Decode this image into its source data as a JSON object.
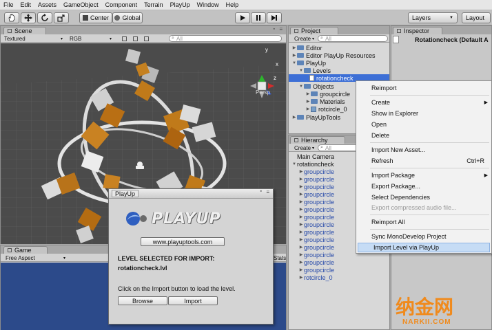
{
  "menu": [
    "File",
    "Edit",
    "Assets",
    "GameObject",
    "Component",
    "Terrain",
    "PlayUp",
    "Window",
    "Help"
  ],
  "toolbar": {
    "pivot": "Center",
    "space": "Global",
    "layers": "Layers",
    "layout": "Layout"
  },
  "scene": {
    "tab": "Scene",
    "shading": "Textured",
    "render_mode": "RGB",
    "search_placeholder": "All",
    "persp": "Persp",
    "gizmo_axes": [
      "y",
      "x",
      "z"
    ]
  },
  "game": {
    "tab": "Game",
    "aspect": "Free Aspect",
    "stats": "Stats"
  },
  "project": {
    "tab": "Project",
    "create": "Create",
    "search_placeholder": "All",
    "items": [
      {
        "label": "Editor",
        "icon": "folder-icon",
        "expanded": false
      },
      {
        "label": "Editor PlayUp Resources",
        "icon": "folder-icon",
        "expanded": false
      },
      {
        "label": "PlayUp",
        "icon": "folder-icon",
        "expanded": true
      },
      {
        "label": "Levels",
        "icon": "folder-icon",
        "expanded": true
      },
      {
        "label": "rotationcheck",
        "icon": "file-icon",
        "selected": true
      },
      {
        "label": "Objects",
        "icon": "folder-icon",
        "expanded": true
      },
      {
        "label": "groupcircle",
        "icon": "folder-icon",
        "expanded": false
      },
      {
        "label": "Materials",
        "icon": "folder-icon",
        "expanded": false
      },
      {
        "label": "rotcircle_0",
        "icon": "prefab-icon",
        "expanded": false
      },
      {
        "label": "PlayUpTools",
        "icon": "folder-icon",
        "expanded": false
      }
    ]
  },
  "hierarchy": {
    "tab": "Hierarchy",
    "create": "Create",
    "search_placeholder": "All",
    "items": [
      "Main Camera",
      "rotationcheck",
      "groupcircle",
      "groupcircle",
      "groupcircle",
      "groupcircle",
      "groupcircle",
      "groupcircle",
      "groupcircle",
      "groupcircle",
      "groupcircle",
      "groupcircle",
      "groupcircle",
      "groupcircle",
      "groupcircle",
      "groupcircle",
      "rotcircle_0"
    ]
  },
  "inspector": {
    "tab": "Inspector",
    "title": "Rotationcheck (Default A"
  },
  "context_menu": [
    {
      "label": "Reimport"
    },
    {
      "sep": true
    },
    {
      "label": "Create",
      "submenu": true
    },
    {
      "label": "Show in Explorer"
    },
    {
      "label": "Open"
    },
    {
      "label": "Delete"
    },
    {
      "sep": true
    },
    {
      "label": "Import New Asset..."
    },
    {
      "label": "Refresh",
      "shortcut": "Ctrl+R"
    },
    {
      "sep": true
    },
    {
      "label": "Import Package",
      "submenu": true
    },
    {
      "label": "Export Package..."
    },
    {
      "label": "Select Dependencies"
    },
    {
      "label": "Export compressed audio file...",
      "disabled": true
    },
    {
      "sep": true
    },
    {
      "label": "Reimport All"
    },
    {
      "sep": true
    },
    {
      "label": "Sync MonoDevelop Project"
    },
    {
      "label": "Import Level via PlayUp",
      "highlighted": true
    }
  ],
  "dialog": {
    "title": "PlayUp",
    "logo_text": "PLAYUP",
    "url_button": "www.playuptools.com",
    "heading": "LEVEL SELECTED FOR IMPORT:",
    "filename": "rotationcheck.lvl",
    "hint": "Click on the Import button to load the level.",
    "browse": "Browse",
    "import": "Import"
  },
  "watermark": {
    "chinese": "纳金网",
    "site": "NARKII.COM"
  },
  "colors": {
    "selection": "#3d6fd6",
    "highlight": "#c6dcf5",
    "scene_bg": "#4a4a4a",
    "game_bg": "#2c4a8a"
  }
}
